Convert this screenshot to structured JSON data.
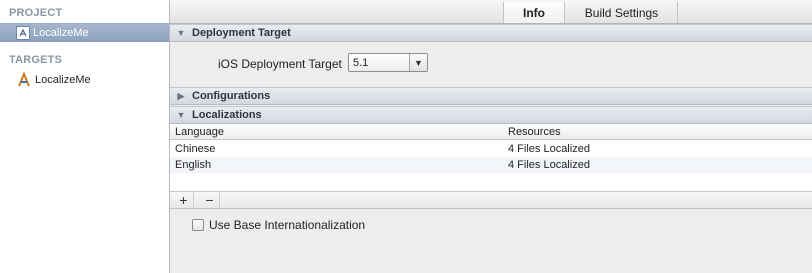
{
  "sidebar": {
    "project_header": "PROJECT",
    "project_item": "LocalizeMe",
    "targets_header": "TARGETS",
    "target_item": "LocalizeMe"
  },
  "tabs": {
    "info": "Info",
    "build_settings": "Build Settings"
  },
  "deployment": {
    "section_title": "Deployment Target",
    "field_label": "iOS Deployment Target",
    "value": "5.1"
  },
  "configurations": {
    "section_title": "Configurations"
  },
  "localizations": {
    "section_title": "Localizations",
    "columns": [
      "Language",
      "Resources"
    ],
    "rows": [
      {
        "language": "Chinese",
        "resources": "4 Files Localized"
      },
      {
        "language": "English",
        "resources": "4 Files Localized"
      }
    ],
    "add_label": "+",
    "remove_label": "−"
  },
  "base_internationalization": {
    "label": "Use Base Internationalization",
    "checked": false
  },
  "colors": {
    "selection": "#9aaac3",
    "section_header": "#d9dde4"
  }
}
